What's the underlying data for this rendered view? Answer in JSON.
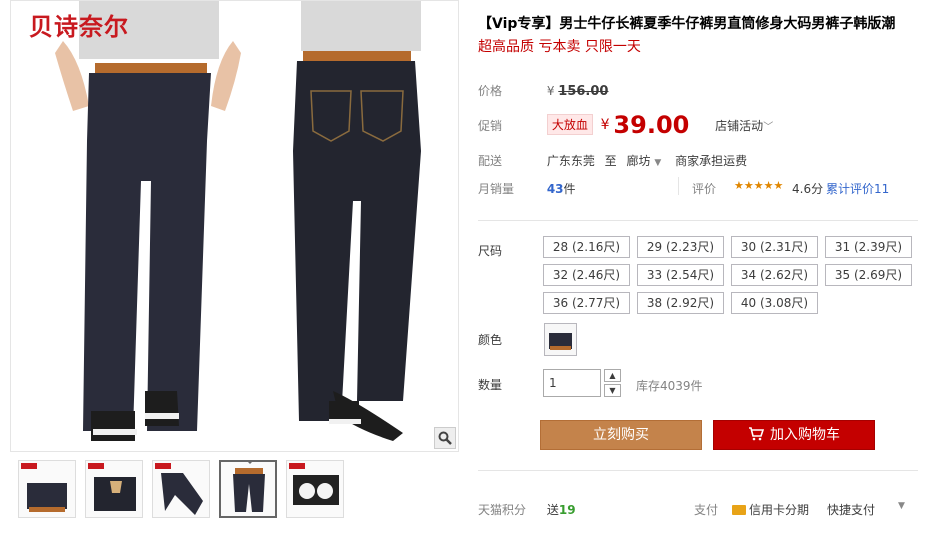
{
  "brand": {
    "logo_text": "贝诗奈尔"
  },
  "product": {
    "title": "【Vip专享】男士牛仔长裤夏季牛仔裤男直筒修身大码男裤子韩版潮",
    "subtitle": "超高品质 亏本卖 只限一天"
  },
  "price": {
    "orig_label": "价格",
    "orig_currency": "¥",
    "orig_value": "156.00",
    "promo_label": "促销",
    "promo_badge": "大放血",
    "promo_currency": "¥",
    "promo_value": "39.00",
    "shop_activity": "店铺活动"
  },
  "shipping": {
    "label": "配送",
    "from": "广东东莞",
    "to_word": "至",
    "to": "廊坊",
    "fee": "商家承担运费"
  },
  "sales": {
    "label": "月销量",
    "count": "43",
    "unit": "件",
    "review_label": "评价",
    "stars": "★★★★★",
    "rating_value": 4.6,
    "rating_text": "4.6分",
    "review_count": "累计评价11"
  },
  "sizes": {
    "label": "尺码",
    "options": [
      "28 (2.16尺)",
      "29 (2.23尺)",
      "30 (2.31尺)",
      "31 (2.39尺)",
      "32 (2.46尺)",
      "33 (2.54尺)",
      "34 (2.62尺)",
      "35 (2.69尺)",
      "36 (2.77尺)",
      "38 (2.92尺)",
      "40 (3.08尺)"
    ]
  },
  "color": {
    "label": "颜色"
  },
  "quantity": {
    "label": "数量",
    "value": "1",
    "stock": "库存4039件"
  },
  "actions": {
    "buy": "立刻购买",
    "cart": "加入购物车"
  },
  "footer": {
    "points_label": "天猫积分",
    "points_send": "送",
    "points_value": "19",
    "pay_label": "支付",
    "credit": "信用卡分期",
    "quick": "快捷支付"
  },
  "colors": {
    "accent": "#c40000",
    "buy": "#c4834b",
    "link": "#3366cc"
  }
}
